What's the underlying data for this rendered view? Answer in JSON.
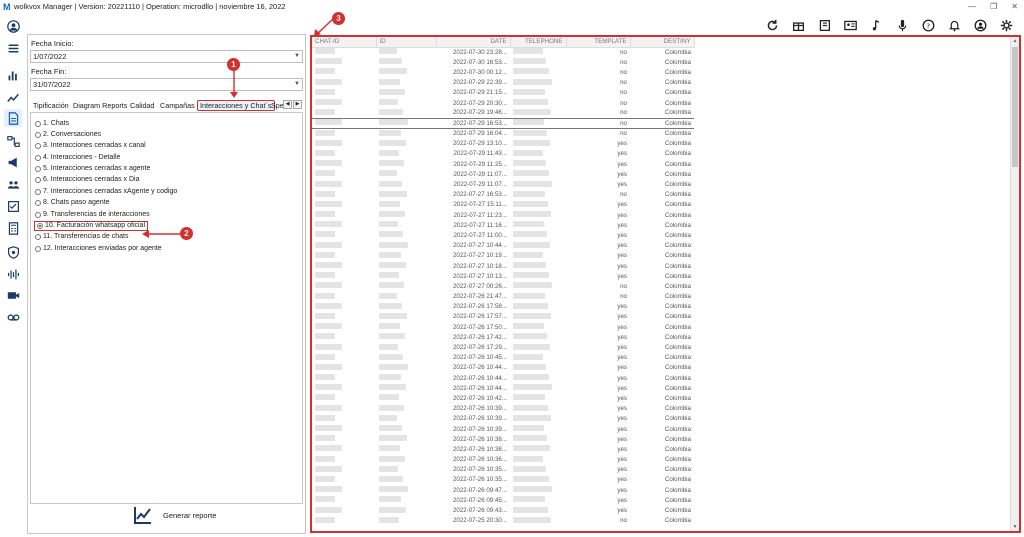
{
  "window": {
    "title": "wolkvox Manager  | Version: 20221110  |  Operation: microdllo  |  noviembre 16, 2022",
    "minimize": "—",
    "restore": "❐",
    "close": "✕"
  },
  "toolbar_icons": [
    "refresh-icon",
    "gift-icon",
    "book-icon",
    "contact-card-icon",
    "music-icon",
    "microphone-icon",
    "help-icon",
    "bell-icon",
    "user-icon",
    "settings-icon"
  ],
  "rail_icons": [
    "user-avatar-icon",
    "menu-icon",
    "bar-chart-icon",
    "trend-icon",
    "report-icon",
    "flow-icon",
    "megaphone-icon",
    "group-icon",
    "checklist-icon",
    "calculator-icon",
    "shield-icon",
    "audio-wave-icon",
    "video-icon",
    "voicemail-icon"
  ],
  "filters": {
    "start_label": "Fecha Inicio:",
    "start_value": "1/07/2022",
    "end_label": "Fecha Fin:",
    "end_value": "31/07/2022"
  },
  "tabs": [
    {
      "label": "Tipificación"
    },
    {
      "label": "Diagram Reports"
    },
    {
      "label": "Calidad"
    },
    {
      "label": "Campañas"
    },
    {
      "label": "Interacciones y Chat´s"
    },
    {
      "label": "Spee"
    }
  ],
  "tab_arrow_left": "◀",
  "tab_arrow_right": "▶",
  "reports": [
    "1. Chats",
    "2. Conversaciones",
    "3. Interacciones cerradas x canal",
    "4. Interacciones - Detalle",
    "5. Interacciones cerradas x agente",
    "6. Interacciones cerradas x Dia",
    "7. Interacciones cerradas xAgente y codigo",
    "8. Chats paso agente",
    "9. Transferencias de interacciones",
    "10. Facturación whatsapp oficial",
    "11. Transferencias de chats",
    "12. Interacciones enviadas por agente"
  ],
  "generate_label": "Generar reporte",
  "callouts": [
    "1",
    "2",
    "3"
  ],
  "table": {
    "columns": [
      "CHAT-ID",
      "ID",
      "DATE",
      "TELEPHONE",
      "TEMPLATE",
      "DESTINY"
    ],
    "rows": [
      [
        "2022-07-30 23:28...",
        "no",
        "Colombia"
      ],
      [
        "2022-07-30 16:53...",
        "no",
        "Colombia"
      ],
      [
        "2022-07-30 00:12...",
        "no",
        "Colombia"
      ],
      [
        "2022-07-29 22:39...",
        "no",
        "Colombia"
      ],
      [
        "2022-07-29 21:15...",
        "no",
        "Colombia"
      ],
      [
        "2022-07-29 20:30...",
        "no",
        "Colombia"
      ],
      [
        "2022-07-29 19:46...",
        "no",
        "Colombia"
      ],
      [
        "2022-07-29 16:53...",
        "no",
        "Colombia"
      ],
      [
        "2022-07-29 16:04...",
        "no",
        "Colombia"
      ],
      [
        "2022-07-29 13:10...",
        "yes",
        "Colombia"
      ],
      [
        "2022-07-29 11:43...",
        "yes",
        "Colombia"
      ],
      [
        "2022-07-29 11:25...",
        "yes",
        "Colombia"
      ],
      [
        "2022-07-29 11:07...",
        "yes",
        "Colombia"
      ],
      [
        "2022-07-29 11:07...",
        "yes",
        "Colombia"
      ],
      [
        "2022-07-27 16:53...",
        "no",
        "Colombia"
      ],
      [
        "2022-07-27 15:11...",
        "yes",
        "Colombia"
      ],
      [
        "2022-07-27 11:23...",
        "yes",
        "Colombia"
      ],
      [
        "2022-07-27 11:16...",
        "yes",
        "Colombia"
      ],
      [
        "2022-07-27 11:00...",
        "yes",
        "Colombia"
      ],
      [
        "2022-07-27 10:44...",
        "yes",
        "Colombia"
      ],
      [
        "2022-07-27 10:19...",
        "yes",
        "Colombia"
      ],
      [
        "2022-07-27 10:18...",
        "yes",
        "Colombia"
      ],
      [
        "2022-07-27 10:13...",
        "yes",
        "Colombia"
      ],
      [
        "2022-07-27 00:26...",
        "no",
        "Colombia"
      ],
      [
        "2022-07-26 21:47...",
        "no",
        "Colombia"
      ],
      [
        "2022-07-26 17:58...",
        "yes",
        "Colombia"
      ],
      [
        "2022-07-26 17:57...",
        "yes",
        "Colombia"
      ],
      [
        "2022-07-26 17:50...",
        "yes",
        "Colombia"
      ],
      [
        "2022-07-26 17:42...",
        "yes",
        "Colombia"
      ],
      [
        "2022-07-26 17:29...",
        "yes",
        "Colombia"
      ],
      [
        "2022-07-26 10:45...",
        "yes",
        "Colombia"
      ],
      [
        "2022-07-26 10:44...",
        "yes",
        "Colombia"
      ],
      [
        "2022-07-26 10:44...",
        "yes",
        "Colombia"
      ],
      [
        "2022-07-26 10:44...",
        "yes",
        "Colombia"
      ],
      [
        "2022-07-26 10:42...",
        "yes",
        "Colombia"
      ],
      [
        "2022-07-26 10:39...",
        "yes",
        "Colombia"
      ],
      [
        "2022-07-26 10:39...",
        "yes",
        "Colombia"
      ],
      [
        "2022-07-26 10:39...",
        "yes",
        "Colombia"
      ],
      [
        "2022-07-26 10:38...",
        "yes",
        "Colombia"
      ],
      [
        "2022-07-26 10:38...",
        "yes",
        "Colombia"
      ],
      [
        "2022-07-26 10:36...",
        "yes",
        "Colombia"
      ],
      [
        "2022-07-26 10:35...",
        "yes",
        "Colombia"
      ],
      [
        "2022-07-26 10:35...",
        "yes",
        "Colombia"
      ],
      [
        "2022-07-26 09:47...",
        "yes",
        "Colombia"
      ],
      [
        "2022-07-26 09:45...",
        "yes",
        "Colombia"
      ],
      [
        "2022-07-26 09:43...",
        "yes",
        "Colombia"
      ],
      [
        "2022-07-25 20:30...",
        "no",
        "Colombia"
      ]
    ]
  },
  "scroll_up": "▲",
  "scroll_down": "▼",
  "accent_color": "#d32f2f"
}
